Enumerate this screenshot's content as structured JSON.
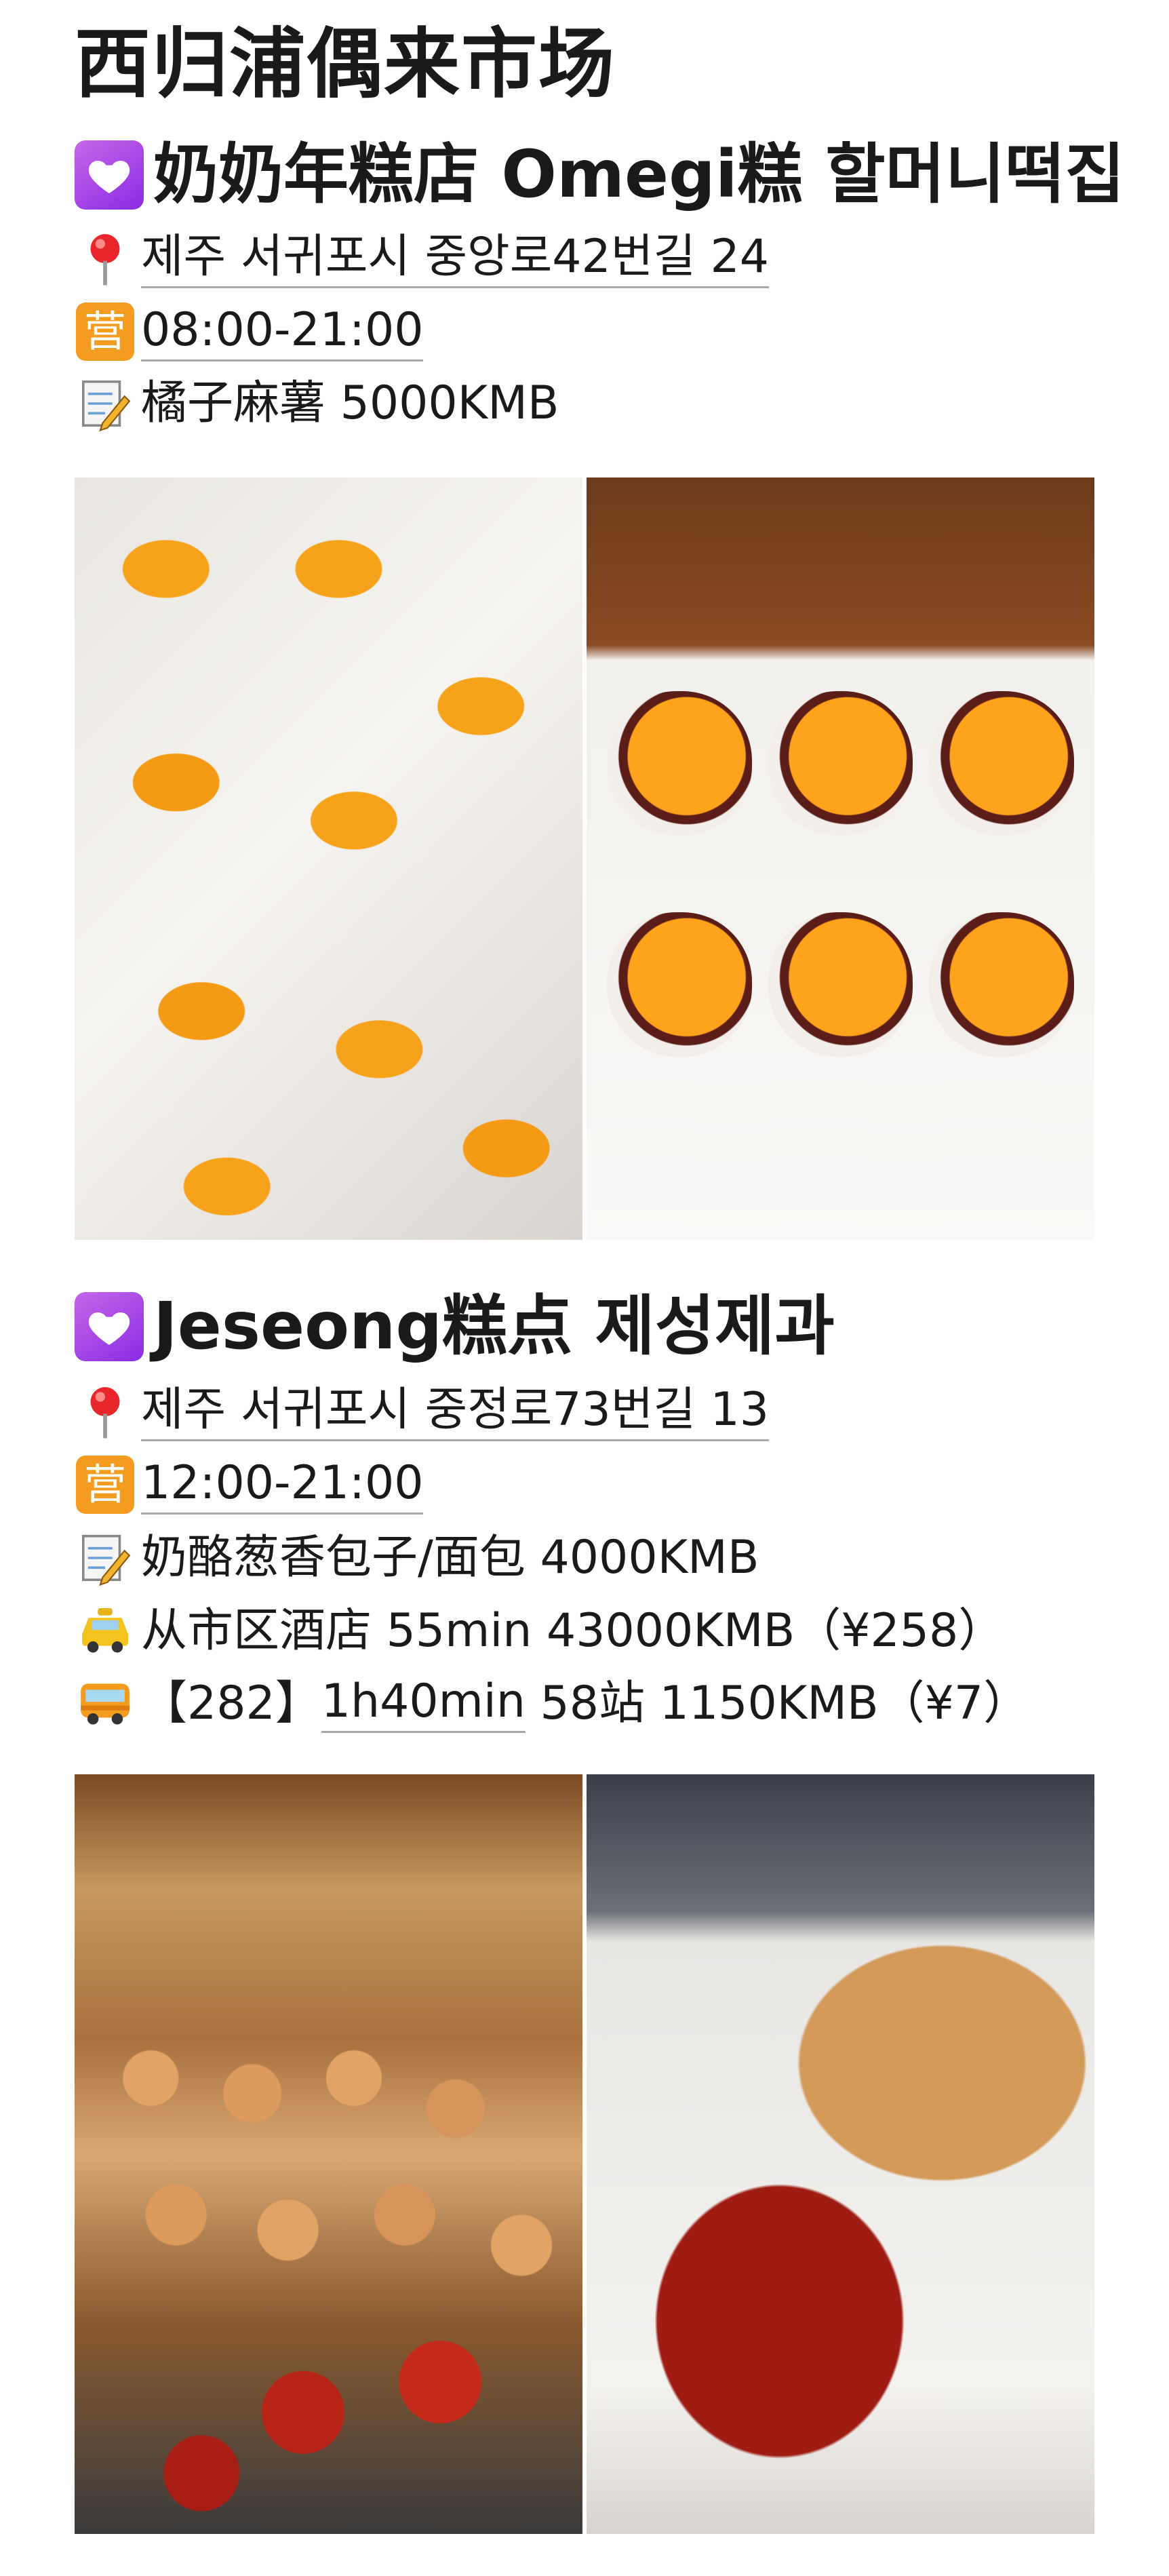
{
  "title": "西归浦偶来市场",
  "shops": [
    {
      "name": "奶奶年糕店 Omegi糕 할머니떡집",
      "address": "제주 서귀포시 중앙로42번길 24",
      "hours_badge": "营",
      "hours": "08:00-21:00",
      "item": "橘子麻薯 5000KMB"
    },
    {
      "name": "Jeseong糕点 제성제과",
      "address": "제주 서귀포시 중정로73번길 13",
      "hours_badge": "营",
      "hours": "12:00-21:00",
      "item": "奶酪葱香包子/面包 4000KMB",
      "taxi": "从市区酒店 55min 43000KMB（¥258）",
      "bus_route": "【282】",
      "bus_time": "1h40min",
      "bus_detail": " 58站 1150KMB（¥7）"
    }
  ],
  "icons": {
    "heart": "heart-icon",
    "pin": "pin-icon",
    "memo": "memo-icon",
    "taxi": "taxi-icon",
    "bus": "bus-icon"
  },
  "colors": {
    "heart_bg": "#9b30e0",
    "hours_badge": "#f39c1f",
    "pin": "#e8262b"
  }
}
